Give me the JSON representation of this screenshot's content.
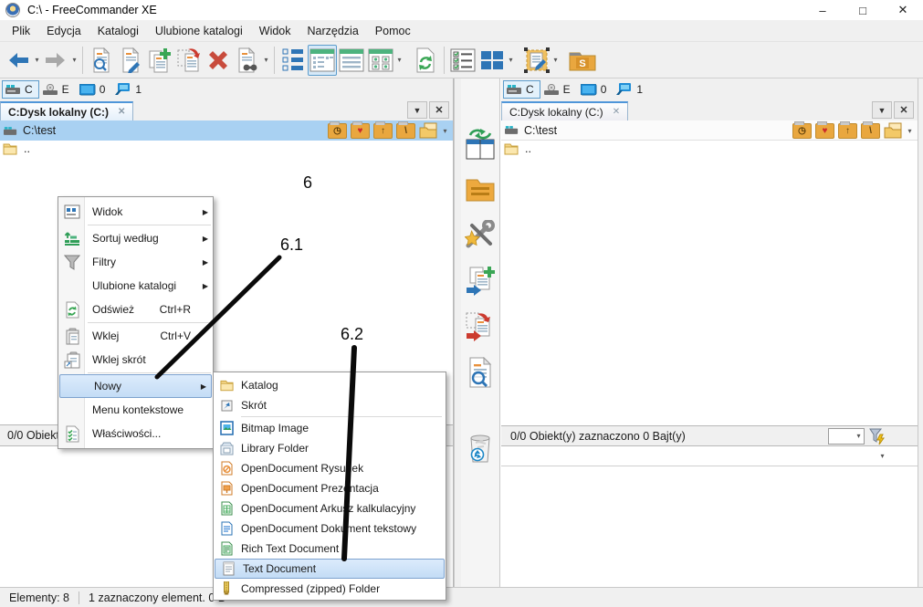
{
  "window": {
    "title": "C:\\ - FreeCommander XE"
  },
  "icons": {
    "minimize": "–",
    "maximize": "□",
    "close": "✕",
    "dropdown": "▼",
    "small_caret": "▾",
    "submenu_arrow": "▶",
    "tab_close": "✕",
    "heart": "♥",
    "up_arrow": "↑",
    "backslash": "\\",
    "clock": "◷",
    "folder_s": "S"
  },
  "menubar": [
    "Plik",
    "Edycja",
    "Katalogi",
    "Ulubione katalogi",
    "Widok",
    "Narzędzia",
    "Pomoc"
  ],
  "drives": [
    "C",
    "E",
    "0",
    "1"
  ],
  "left_panel": {
    "tab": "C:Dysk lokalny (C:)",
    "path": "C:\\test",
    "parent_item": "..",
    "status": "0/0 Obiekt(y) zaznaczono  0 Bajt(y)"
  },
  "right_panel": {
    "tab": "C:Dysk lokalny (C:)",
    "path": "C:\\test",
    "parent_item": "..",
    "status": "0/0 Obiekt(y) zaznaczono   0 Bajt(y)"
  },
  "context_menu": {
    "items": [
      {
        "label": "Widok"
      },
      {
        "label": "Sortuj według"
      },
      {
        "label": "Filtry"
      },
      {
        "label": "Ulubione katalogi"
      },
      {
        "label": "Odśwież",
        "shortcut": "Ctrl+R"
      },
      {
        "label": "Wklej",
        "shortcut": "Ctrl+V"
      },
      {
        "label": "Wklej skrót"
      },
      {
        "label": "Nowy"
      },
      {
        "label": "Menu kontekstowe"
      },
      {
        "label": "Właściwości..."
      }
    ]
  },
  "new_submenu": {
    "items": [
      "Katalog",
      "Skrót",
      "Bitmap Image",
      "Library Folder",
      "OpenDocument Rysunek",
      "OpenDocument Prezentacja",
      "OpenDocument Arkusz kalkulacyjny",
      "OpenDocument Dokument tekstowy",
      "Rich Text Document",
      "Text Document",
      "Compressed (zipped) Folder"
    ]
  },
  "statusbar": {
    "elements": "Elementy: 8",
    "selection": "1 zaznaczony element. 0 B"
  },
  "annotations": {
    "label_6": "6",
    "label_6_1": "6.1",
    "label_6_2": "6.2"
  }
}
